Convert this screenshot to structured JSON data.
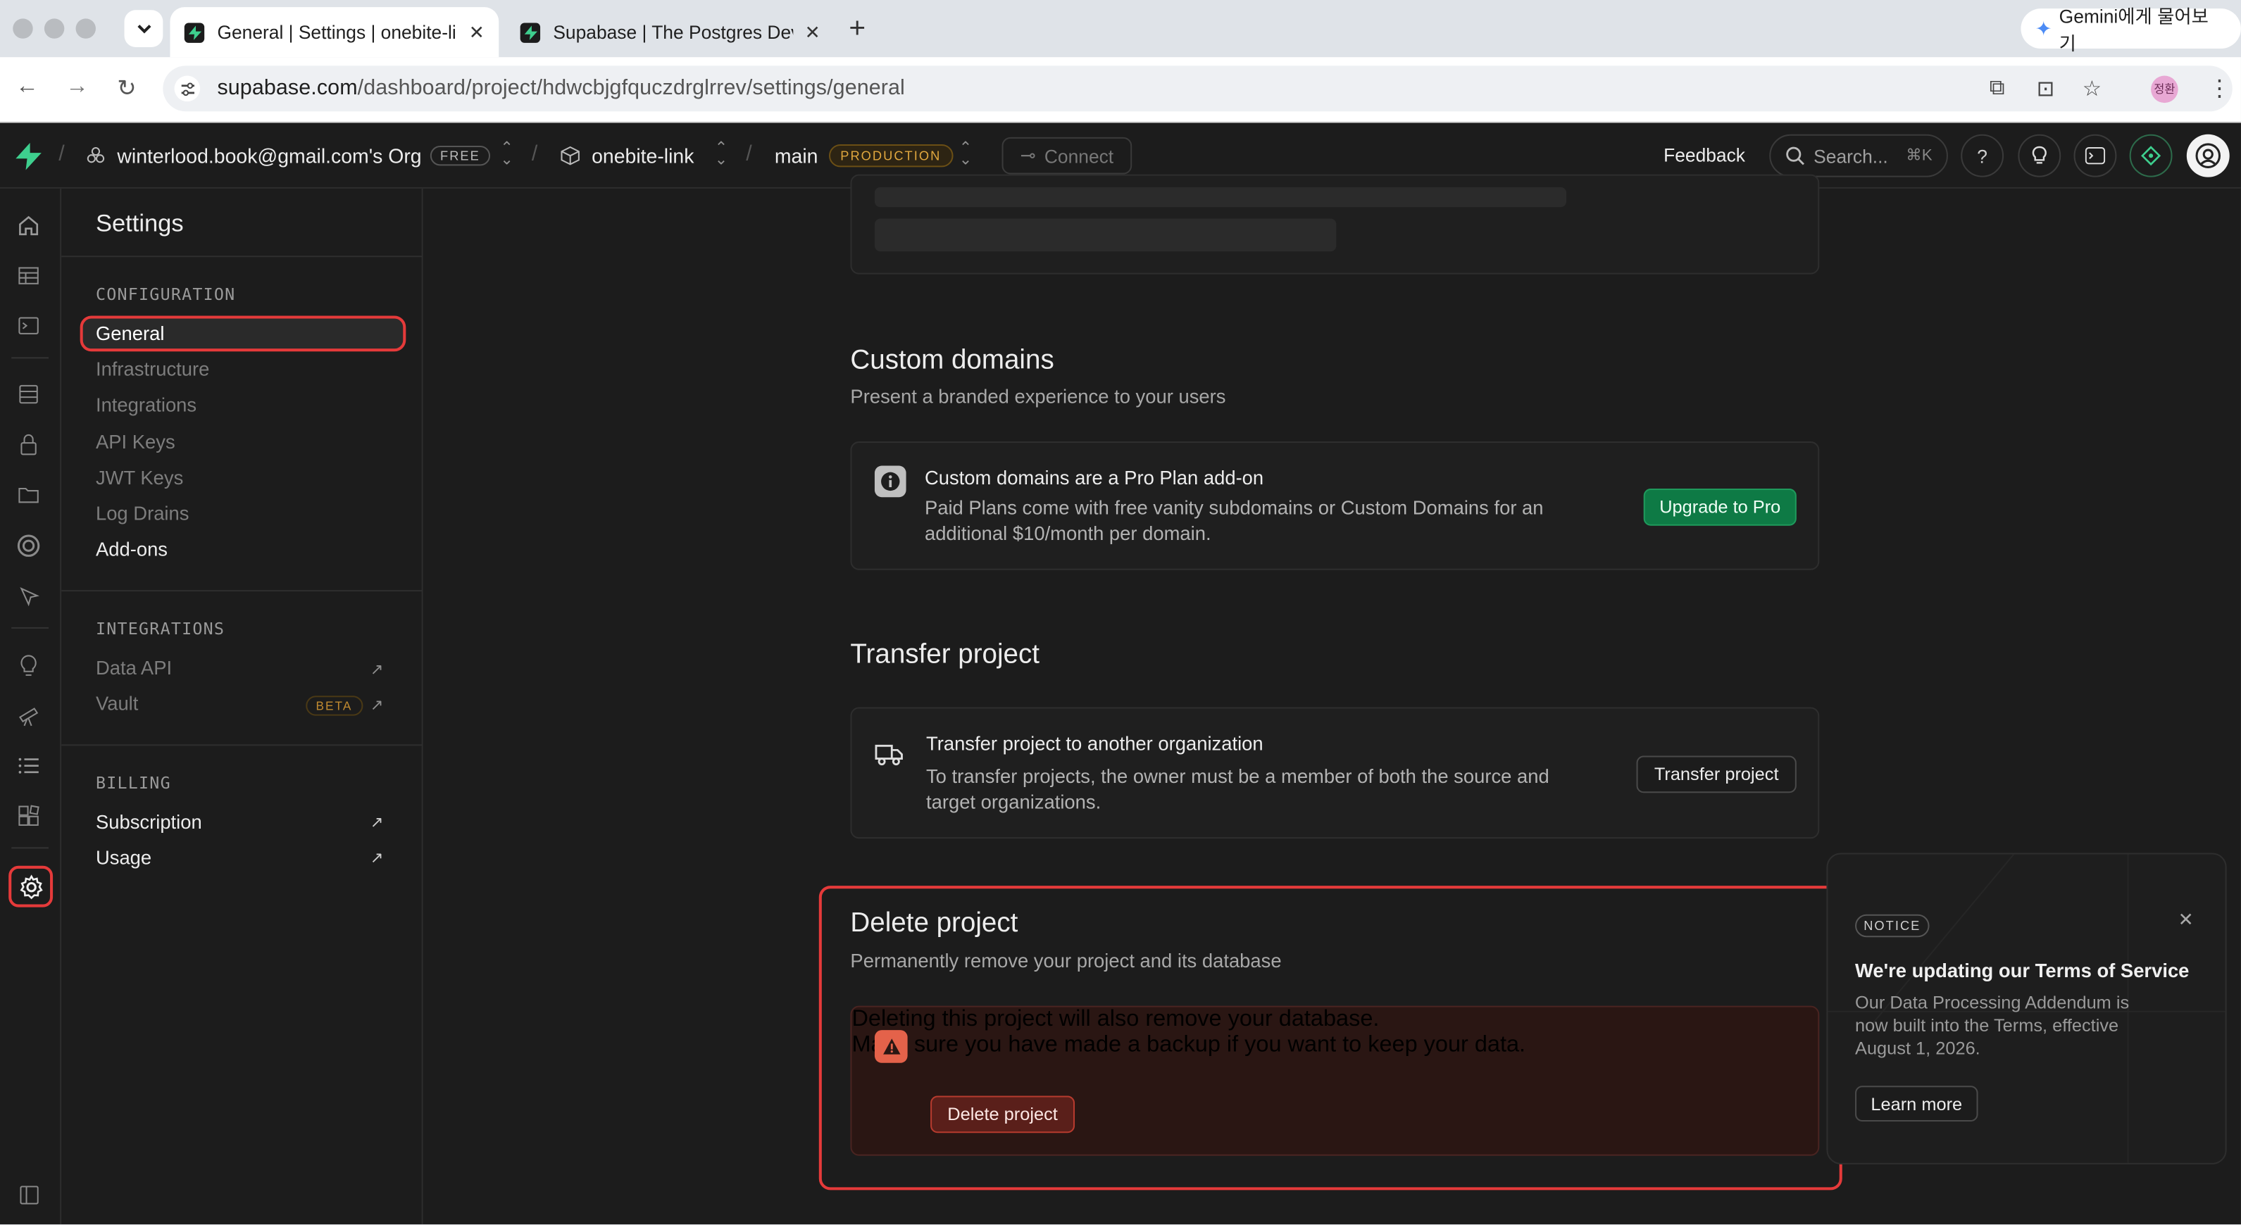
{
  "browser": {
    "tabs": [
      {
        "title": "General | Settings | onebite-link",
        "active": true
      },
      {
        "title": "Supabase | The Postgres Dev",
        "active": false
      }
    ],
    "gemini_label": "Gemini에게 물어보기",
    "url_host": "supabase.com",
    "url_path": "/dashboard/project/hdwcbjgfquczdrglrrev/settings/general",
    "profile_initials": "정환"
  },
  "topnav": {
    "org": "winterlood.book@gmail.com's Org",
    "org_badge": "FREE",
    "project": "onebite-link",
    "branch": "main",
    "branch_badge": "PRODUCTION",
    "connect": "Connect",
    "feedback": "Feedback",
    "search_placeholder": "Search...",
    "search_shortcut": "⌘K"
  },
  "sidebar": {
    "title": "Settings",
    "configuration_header": "CONFIGURATION",
    "configuration_items": [
      "General",
      "Infrastructure",
      "Integrations",
      "API Keys",
      "JWT Keys",
      "Log Drains",
      "Add-ons"
    ],
    "integrations_header": "INTEGRATIONS",
    "integrations_items": [
      "Data API",
      "Vault"
    ],
    "vault_badge": "BETA",
    "billing_header": "BILLING",
    "billing_items": [
      "Subscription",
      "Usage"
    ]
  },
  "custom_domains": {
    "title": "Custom domains",
    "subtitle": "Present a branded experience to your users",
    "card_title": "Custom domains are a Pro Plan add-on",
    "card_desc_1": "Paid Plans come with free vanity subdomains or Custom Domains for an",
    "card_desc_2": "additional $10/month per domain.",
    "button": "Upgrade to Pro"
  },
  "transfer": {
    "title": "Transfer project",
    "card_title": "Transfer project to another organization",
    "card_desc_1": "To transfer projects, the owner must be a member of both the source and",
    "card_desc_2": "target organizations.",
    "button": "Transfer project"
  },
  "delete": {
    "title": "Delete project",
    "subtitle": "Permanently remove your project and its database",
    "card_title": "Deleting this project will also remove your database.",
    "card_desc": "Make sure you have made a backup if you want to keep your data.",
    "button": "Delete project"
  },
  "notice": {
    "badge": "NOTICE",
    "title": "We're updating our Terms of Service",
    "body": "Our Data Processing Addendum is now built into the Terms, effective August 1, 2026.",
    "button": "Learn more"
  },
  "colors": {
    "accent_green": "#0e7a45",
    "danger": "#e53a3a",
    "production_badge": "#e0a73e",
    "background": "#1c1c1c"
  }
}
